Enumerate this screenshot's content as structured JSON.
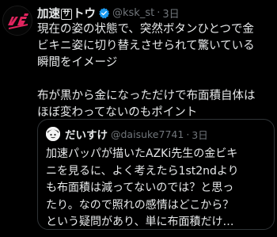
{
  "tweet": {
    "display_name_prefix": "加速",
    "display_name_boxed": "サ",
    "display_name_suffix": "トウ",
    "handle": "@ksk_st",
    "separator": "·",
    "time": "3日",
    "body_lines": [
      "現在の姿の状態で、突然ボタンひとつで金",
      "ビキニ姿に切り替えさせられて驚いている",
      "瞬間をイメージ",
      "",
      "布が黒から金になっただけで布面積自体は",
      "ほぼ変わってないのもポイント"
    ],
    "icons": {
      "verified": "verified-badge-icon",
      "avatar": "ksk-logo-avatar"
    },
    "colors": {
      "verified_badge": "#1d9bf0",
      "avatar_logo": "#e0245e"
    }
  },
  "quote": {
    "display_name": "だいすけ",
    "handle": "@daisuke7741",
    "separator": "·",
    "time": "3日",
    "lines": [
      "加速パッパが描いたAZKi先生の金ビキ",
      "ニを見るに、よく考えたら1st2ndより",
      "も布面積は減ってないのでは？と思っ",
      "たり。なので照れの感情はどこから？",
      "という疑問があり、単に布面積だけ…"
    ]
  }
}
